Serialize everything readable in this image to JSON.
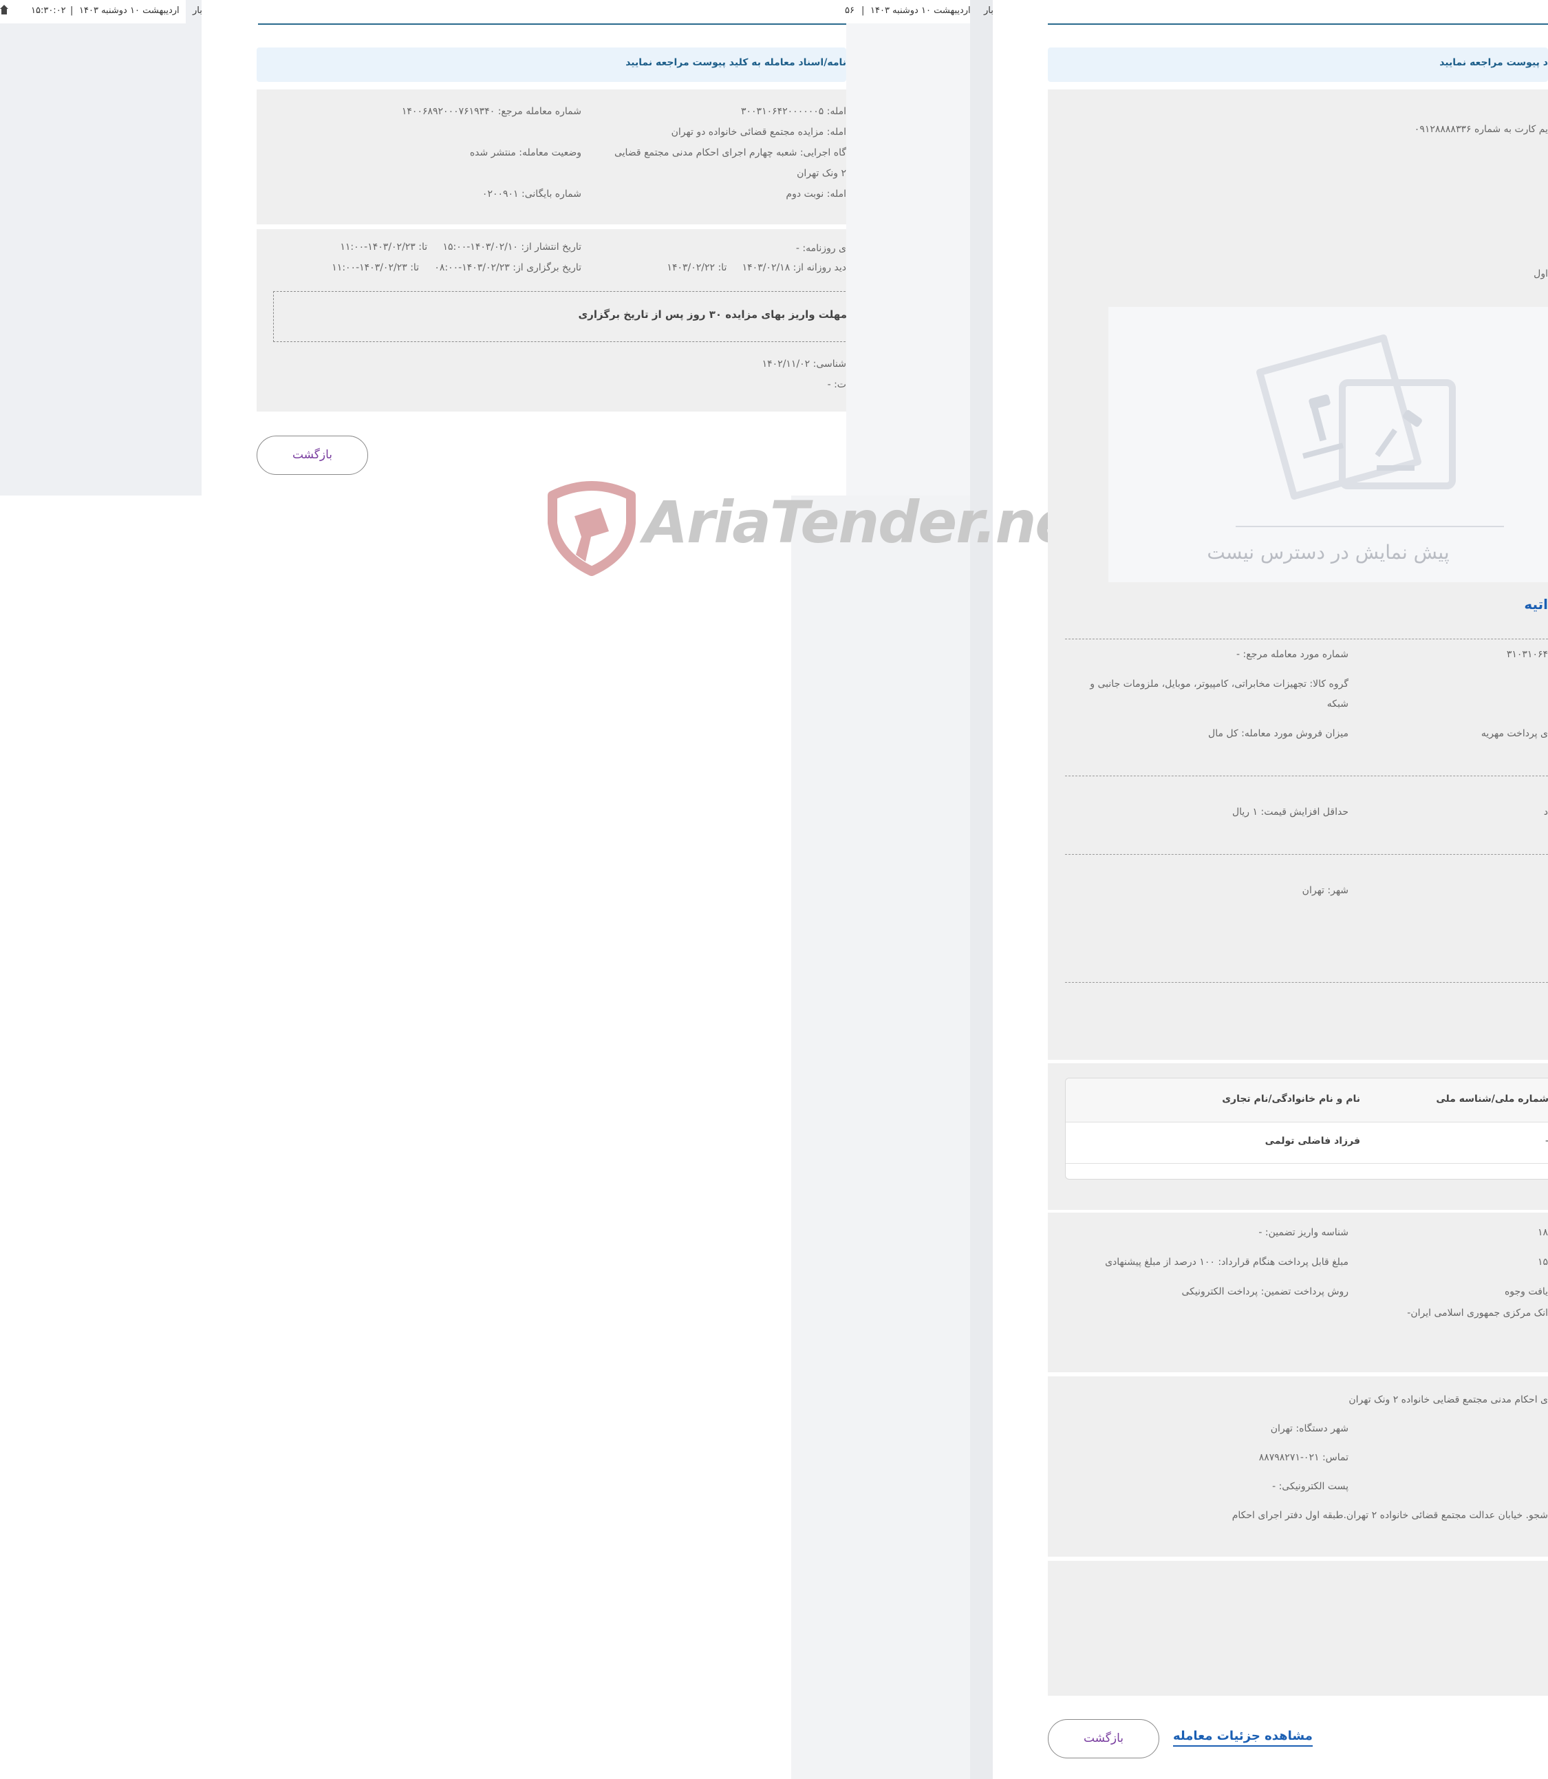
{
  "left_window": {
    "topbar_date": "اردیبهشت ۱۰ دوشنبه ۱۴۰۳",
    "topbar_sep": "|",
    "topbar_time": "۱۵:۳۰:۰۲",
    "topbar_tail": "بار"
  },
  "first_page": {
    "topbar_prefix": "۵۶",
    "topbar_sep": "|",
    "topbar_date": "اردیبهشت ۱۰ دوشنبه ۱۴۰۳",
    "topbar_tail": "بار",
    "alert": "نامه/اسناد معامله به کلید پیوست مراجعه نمایید",
    "details": {
      "deal_no_label": "امله:",
      "deal_no_value": "۳۰۰۳۱۰۶۴۲۰۰۰۰۰۰۵",
      "ref_no_label": "شماره معامله مرجع:",
      "ref_no_value": "۱۴۰۰۶۸۹۲۰۰۰۷۶۱۹۳۴۰",
      "title_label": "امله:",
      "title_value": "مزایده مجتمع قضائی خانواده دو تهران",
      "exec_label": "گاه اجرایی:",
      "exec_value": "شعبه چهارم اجرای احکام مدنی مجتمع قضایی",
      "exec_value2": "۲ ونک تهران",
      "status_label": "وضعیت معامله:",
      "status_value": "منتشر شده",
      "round_label": "امله:",
      "round_value": "نوبت دوم",
      "archive_label": "شماره بایگانی:",
      "archive_value": "۰۲۰۰۹۰۱"
    },
    "dates": {
      "newspaper_label": "ی روزنامه:",
      "newspaper_value": "-",
      "publish_label": "تاریخ انتشار از:",
      "publish_from": "۱۴۰۳/۰۲/۱۰-۱۵:۰۰",
      "publish_to_label": "تا:",
      "publish_to": "۱۴۰۳/۰۲/۲۳-۱۱:۰۰",
      "visit_label": "دید روزانه از:",
      "visit_from": "۱۴۰۳/۰۲/۱۸",
      "visit_to_label": "تا:",
      "visit_to": "۱۴۰۳/۰۲/۲۲",
      "hold_label": "تاریخ برگزاری از:",
      "hold_from": "۱۴۰۳/۰۲/۲۳-۰۸:۰۰",
      "hold_to_label": "تا:",
      "hold_to": "۱۴۰۳/۰۲/۲۳-۱۱:۰۰",
      "note": "مهلت واریز بهای مزایده ۳۰ روز پس از تاریخ برگزاری",
      "expert_label": "شناسی:",
      "expert_value": "۱۴۰۲/۱۱/۰۲",
      "extra_label": "ت:",
      "extra_value": "-"
    },
    "back_button": "بازگشت"
  },
  "watermark": "AriaTender.neT",
  "second_page": {
    "alert": "د پیوست مراجعه نمایید",
    "sim_text": "یم کارت به شماره ۰۹۱۲۸۸۸۸۳۳۶",
    "first_word": "اول",
    "no_preview": "پیش نمایش در دسترس نیست",
    "section_link": "اتیه",
    "item": {
      "no_value": "۳۱۰۳۱۰۶۴",
      "ref_label": "شماره مورد معامله مرجع:",
      "ref_value": "-",
      "group_label": "گروه کالا:",
      "group_value": "تجهیزات مخابراتی، کامپیوتر، موبایل، ملزومات جانبی و",
      "group_value2": "شبکه",
      "reason_fragment": "ی پرداخت مهریه",
      "sale_label": "میزان فروش مورد معامله:",
      "sale_value": "کل مال",
      "min_inc_fragment": "د",
      "min_inc_label": "حداقل افزایش قیمت:",
      "min_inc_value": "۱ ریال",
      "city_label": "شهر:",
      "city_value": "تهران"
    },
    "owners_table": {
      "headers": [
        "شماره ملی/شناسه ملی",
        "نام و نام خانوادگی/نام تجاری"
      ],
      "rows": [
        [
          "-",
          "فرزاد فاضلی تولمی"
        ]
      ]
    },
    "payment": {
      "frag1": "۱۸",
      "deposit_id_label": "شناسه واریز تضمین:",
      "deposit_id_value": "-",
      "frag2": "۱۵",
      "contract_label": "مبلغ قابل پرداخت هنگام قرارداد:",
      "contract_value": "۱۰۰ درصد از مبلغ پیشنهادی",
      "frag3": "یافت وجوه",
      "method_label": "روش پرداخت تضمین:",
      "method_value": "پرداخت الکترونیکی",
      "bank_fragment": "انک مرکزی جمهوری اسلامی ایران-"
    },
    "contact": {
      "org_fragment": "ی احکام مدنی مجتمع قضایی خانواده ۲ ونک تهران",
      "city_label": "شهر دستگاه:",
      "city_value": "تهران",
      "phone_label": "تماس:",
      "phone_value": "۰۲۱-۸۸۷۹۸۲۷۱",
      "email_label": "پست الکترونیکی:",
      "email_value": "-",
      "address_fragment": "شجو. خیابان عدالت مجتمع قضائی خانواده ۲ تهران.طبقه اول دفتر اجرای احکام"
    },
    "back_button": "بازگشت",
    "details_link": "مشاهده جزئیات معامله"
  },
  "colors": {
    "accent_blue": "#1b5fb3",
    "button_text": "#7a3fa0",
    "header_line": "#2a6a8d",
    "watermark_red": "#d8a7a9",
    "watermark_gray": "#c7c7c7"
  }
}
